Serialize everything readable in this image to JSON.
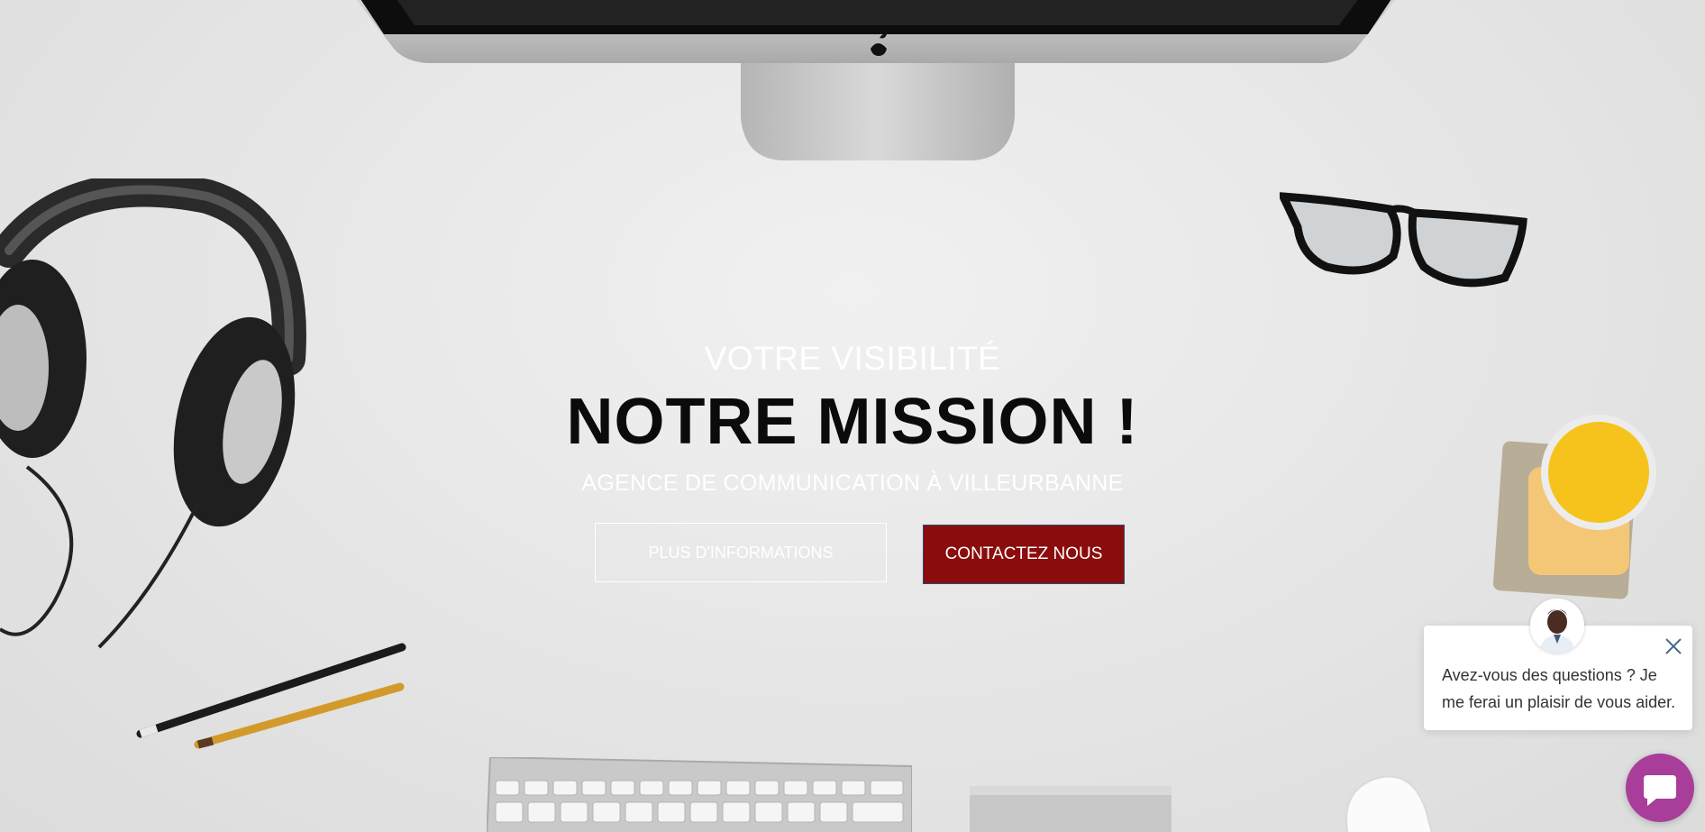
{
  "hero": {
    "kicker": "VOTRE VISIBILITÉ",
    "title": "NOTRE MISSION !",
    "subtitle": "AGENCE DE COMMUNICATION À VILLEURBANNE",
    "buttons": {
      "info_label": "PLUS D'INFORMATIONS",
      "contact_label": "CONTACTEZ NOUS"
    }
  },
  "chat": {
    "message": "Avez-vous des questions ? Je me ferai un plaisir de vous aider.",
    "avatar_icon": "agent-avatar",
    "close_icon": "close-icon",
    "launcher_icon": "chat-bubble-icon"
  },
  "colors": {
    "contact_button": "#8b0c0c",
    "chat_launcher": "#a83e9a",
    "hero_title": "#0b0b0b",
    "hero_text": "#ffffff"
  }
}
